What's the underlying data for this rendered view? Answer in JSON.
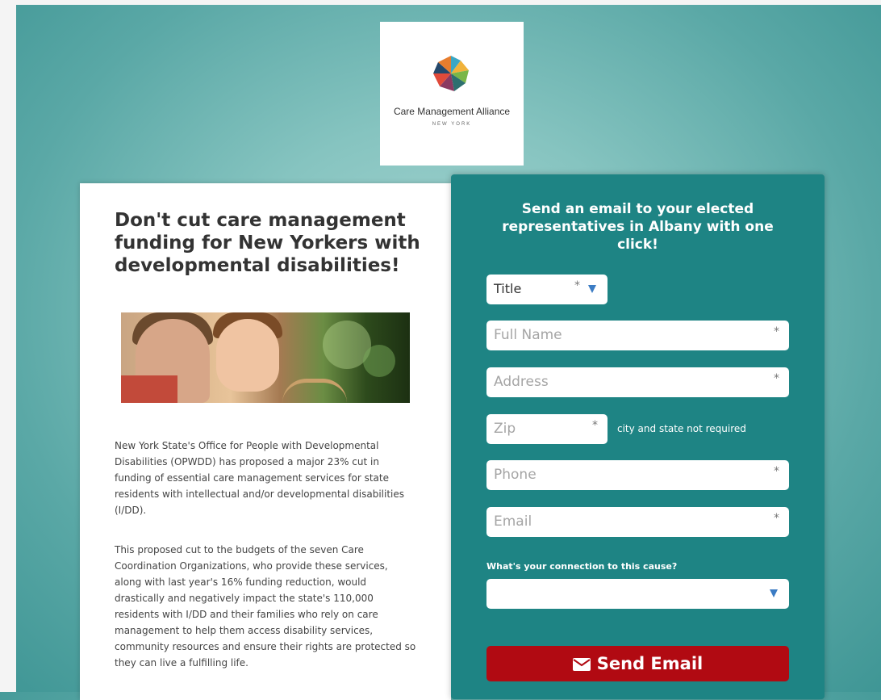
{
  "logo": {
    "name": "Care Management Alliance",
    "sub": "NEW YORK"
  },
  "article": {
    "headline": "Don't cut care management funding for New Yorkers with developmental disabilities!",
    "paragraphs": [
      "New York State's Office for People with Developmental Disabilities (OPWDD) has proposed a major 23% cut in funding of essential care management services for state residents with intellectual and/or developmental disabilities (I/DD).",
      "This proposed cut to the budgets of the seven Care Coordination Organizations, who provide these services, along with last year's 16% funding reduction, would drastically and negatively impact the state's 110,000 residents with I/DD and their families who rely on care management to help them access disability services, community resources and ensure their rights are protected so they can live a fulfilling life."
    ]
  },
  "form": {
    "title": "Send an email to your elected representatives in Albany with one click!",
    "title_select": "Title",
    "full_name_placeholder": "Full Name",
    "address_placeholder": "Address",
    "zip_placeholder": "Zip",
    "zip_note": "city and state not required",
    "phone_placeholder": "Phone",
    "email_placeholder": "Email",
    "required_mark": "*",
    "connection_label": "What's your connection to this cause?",
    "connection_value": "",
    "send_label": "Send Email"
  },
  "colors": {
    "form_bg": "#1e8484",
    "send_button": "#b10a12",
    "dropdown_arrow": "#3b7cc4"
  },
  "icons": {
    "send": "envelope-icon",
    "dropdown": "triangle-down-icon"
  }
}
